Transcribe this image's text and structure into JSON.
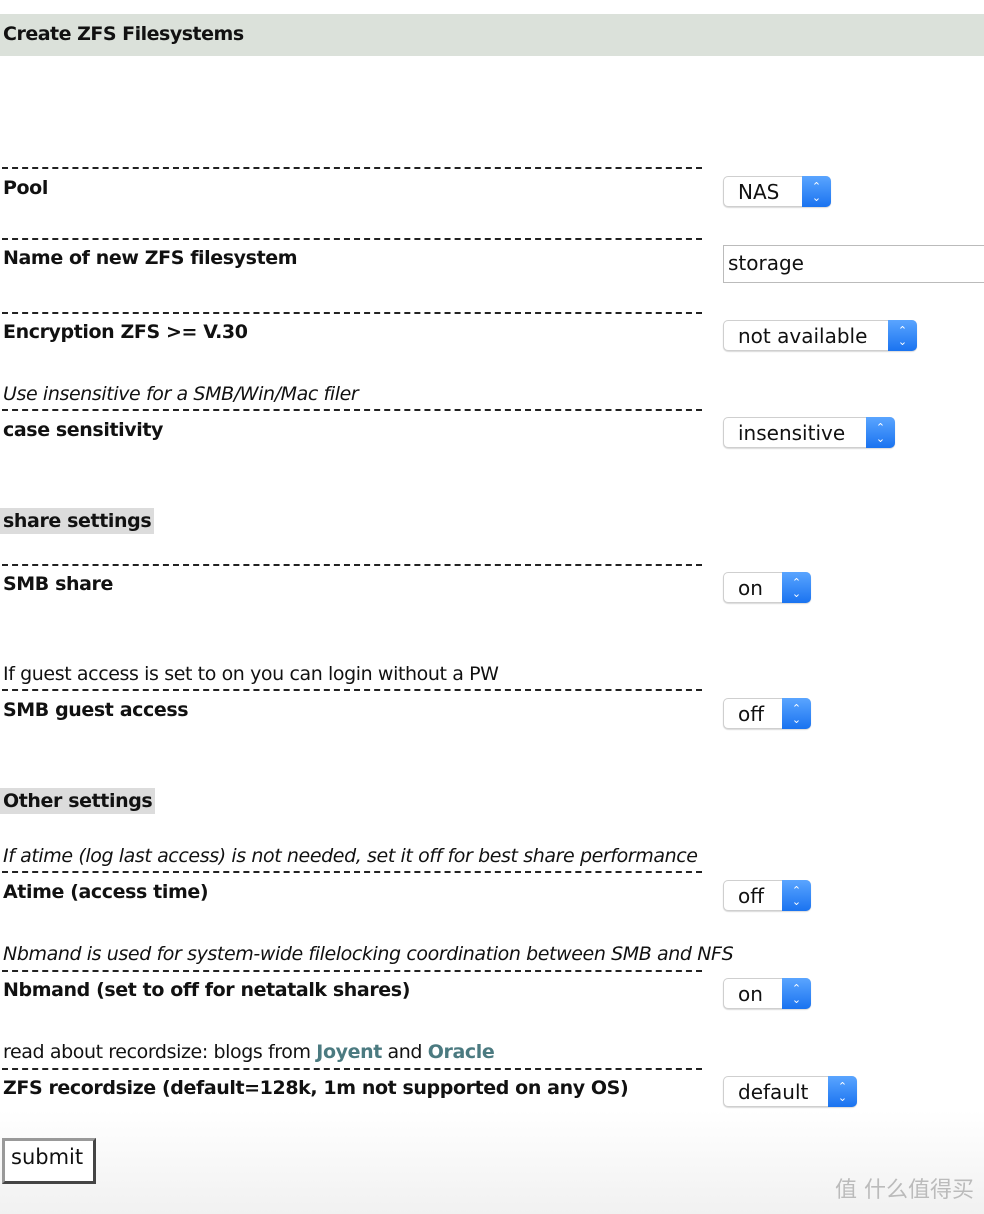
{
  "title": "Create ZFS Filesystems",
  "fields": {
    "pool": {
      "label": "Pool",
      "value": "NAS"
    },
    "name": {
      "label": "Name of new ZFS filesystem",
      "value": "storage"
    },
    "encryption": {
      "label": "Encryption ZFS >= V.30",
      "value": "not available"
    },
    "case": {
      "hint": "Use insensitive for a SMB/Win/Mac filer",
      "label": "case sensitivity",
      "value": "insensitive"
    },
    "smb_share": {
      "label": "SMB share",
      "value": "on"
    },
    "smb_guest": {
      "hint": "If guest access is set to on you can login without a PW",
      "label": "SMB guest access",
      "value": "off"
    },
    "atime": {
      "hint": "If atime (log last access) is not needed, set it off for best share performance",
      "label": "Atime (access time)",
      "value": "off"
    },
    "nbmand": {
      "hint": "Nbmand is used for system-wide filelocking coordination between SMB and NFS",
      "label": "Nbmand (set to off for netatalk shares)",
      "value": "on"
    },
    "recordsize": {
      "hint_prefix": "read about recordsize: blogs from",
      "link1": "Joyent",
      "hint_and": "and",
      "link2": "Oracle",
      "label": "ZFS recordsize (default=128k, 1m not supported on any OS)",
      "value": "default"
    }
  },
  "sections": {
    "share": "share settings",
    "other": "Other settings"
  },
  "submit": "submit",
  "watermark": "值 什么值得买",
  "colors": {
    "header_bg": "#dbe1da",
    "link": "#4b7a80",
    "select_accent": "#1a73f0"
  }
}
